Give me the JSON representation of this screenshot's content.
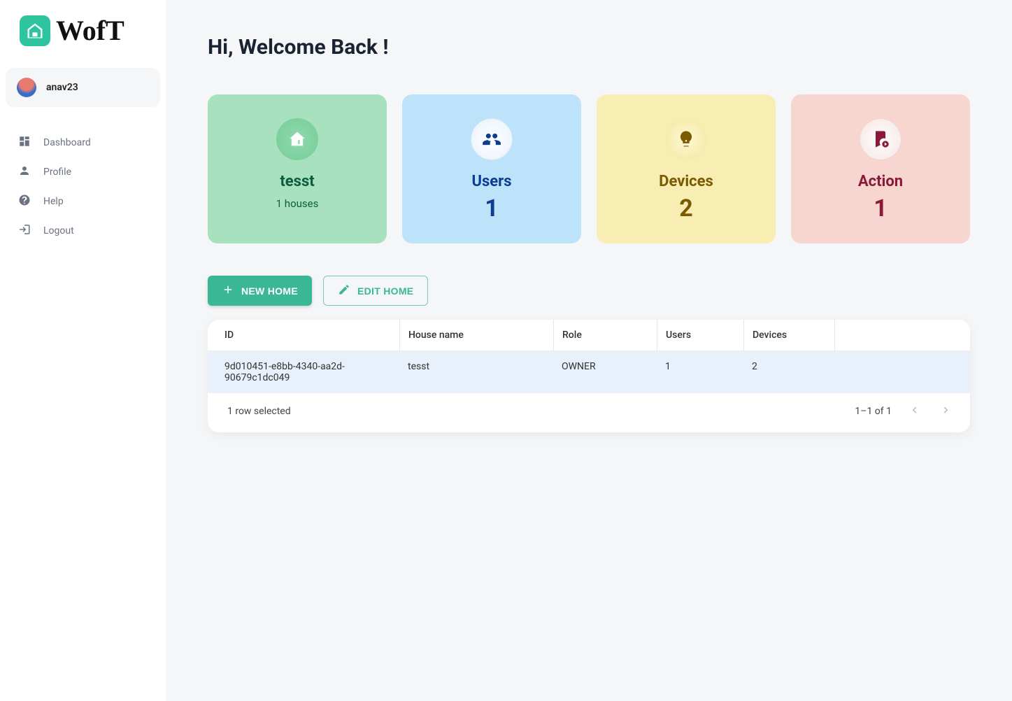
{
  "brand": {
    "name": "WofT"
  },
  "user": {
    "name": "anav23"
  },
  "nav": {
    "dashboard": "Dashboard",
    "profile": "Profile",
    "help": "Help",
    "logout": "Logout"
  },
  "header": {
    "title": "Hi, Welcome Back !"
  },
  "cards": {
    "house": {
      "title": "tesst",
      "subtitle": "1 houses"
    },
    "users": {
      "title": "Users",
      "value": "1"
    },
    "devices": {
      "title": "Devices",
      "value": "2"
    },
    "action": {
      "title": "Action",
      "value": "1"
    }
  },
  "buttons": {
    "new_home": "New Home",
    "edit_home": "Edit Home"
  },
  "table": {
    "columns": {
      "id": "ID",
      "house_name": "House name",
      "role": "Role",
      "users": "Users",
      "devices": "Devices"
    },
    "rows": [
      {
        "id": "9d010451-e8bb-4340-aa2d-90679c1dc049",
        "house_name": "tesst",
        "role": "OWNER",
        "users": "1",
        "devices": "2"
      }
    ],
    "footer": {
      "selected": "1 row selected",
      "range": "1–1 of 1"
    }
  }
}
